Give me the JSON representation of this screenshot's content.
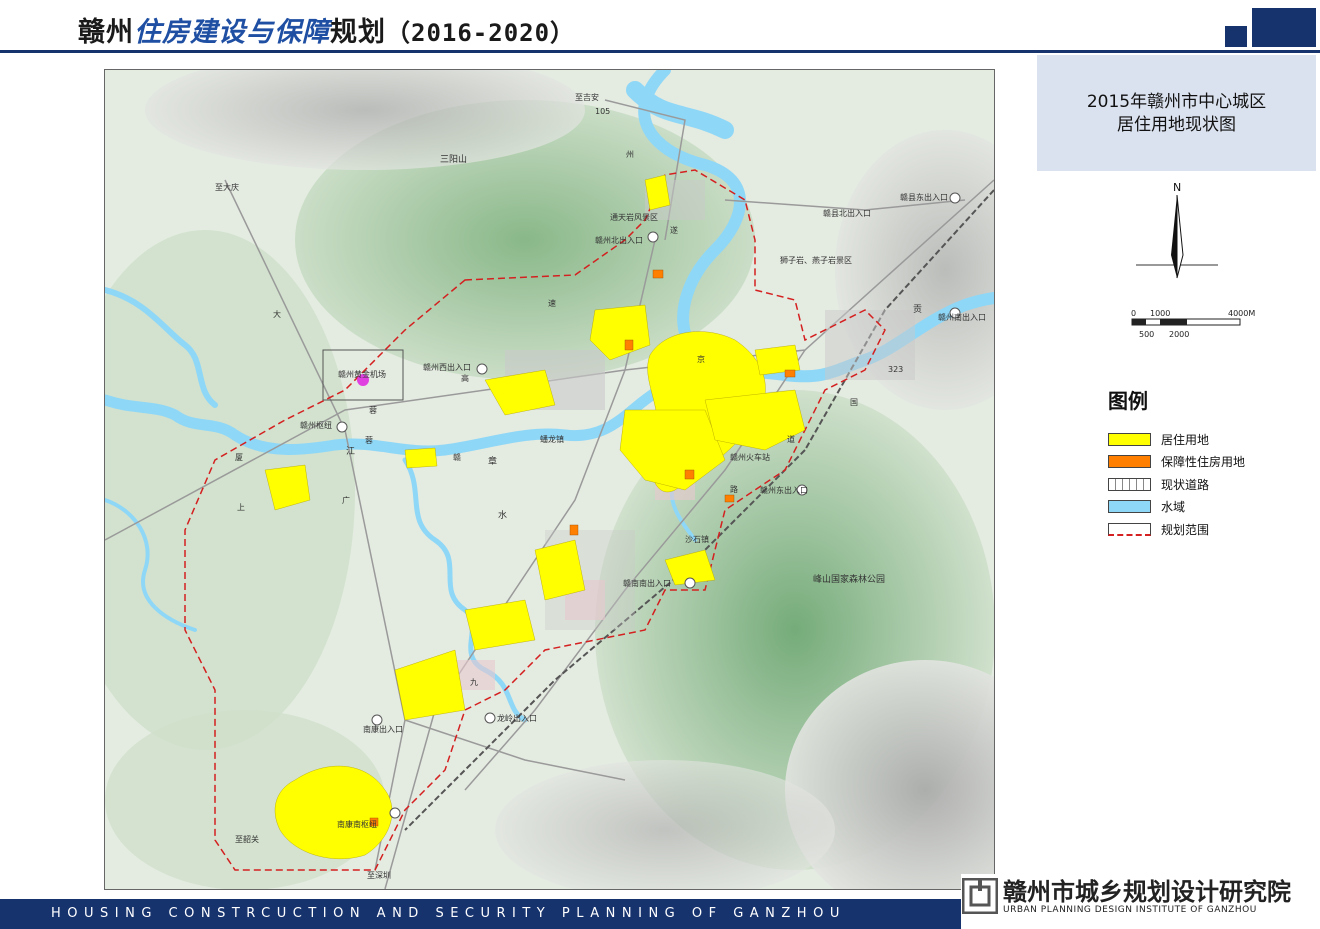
{
  "header": {
    "title_prefix": "赣州",
    "title_highlight": "住房建设与保障",
    "title_suffix": "规划",
    "title_years": "（2016-2020）"
  },
  "panel": {
    "map_title_line1": "2015年赣州市中心城区",
    "map_title_line2": "居住用地现状图"
  },
  "north_arrow": {
    "label": "N"
  },
  "scale_bar": {
    "top_labels": [
      "0",
      "1000",
      "4000M"
    ],
    "bottom_labels": [
      "500",
      "2000"
    ]
  },
  "legend": {
    "title": "图例",
    "items": [
      {
        "label": "居住用地",
        "swatch": "#ffff00"
      },
      {
        "label": "保障性住房用地",
        "swatch": "#ff8000"
      },
      {
        "label": "现状道路",
        "swatch": "road"
      },
      {
        "label": "水域",
        "swatch": "#8fd7f7"
      },
      {
        "label": "规划范围",
        "swatch": "boundary"
      }
    ]
  },
  "map": {
    "labels": [
      "至吉安",
      "105",
      "三阳山",
      "至大庆",
      "通天岩风景区",
      "赣州北出入口",
      "赣县北出入口",
      "赣县东出入口",
      "狮子岩、燕子岩景区",
      "赣州南出入口",
      "赣州西出入口",
      "赣州黄金机场",
      "赣州枢纽",
      "323",
      "赣州火车站",
      "赣州东出入口",
      "蟠龙镇",
      "沙石镇",
      "赣南南出入口",
      "峰山国家森林公园",
      "龙岭出入口",
      "南康出入口",
      "南康南枢纽",
      "至韶关",
      "至深圳",
      "大",
      "高",
      "速",
      "厦",
      "蓉",
      "江",
      "章",
      "水",
      "广",
      "上",
      "贡",
      "国",
      "道",
      "路",
      "赣",
      "遂",
      "蓉",
      "州",
      "九",
      "京"
    ]
  },
  "footer": {
    "tagline": "HOUSING CONSTRCUCTION AND SECURITY PLANNING OF GANZHOU",
    "institute_cn": "赣州市城乡规划设计研究院",
    "institute_en": "URBAN PLANNING DESIGN INSTITUTE OF GANZHOU"
  },
  "colors": {
    "brand_navy": "#17336e",
    "title_blue": "#1f4fa3",
    "panel_bg": "#dbe2ef",
    "residential": "#ffff00",
    "affordable": "#ff8000",
    "water": "#8fd7f7",
    "boundary": "#d42020"
  }
}
